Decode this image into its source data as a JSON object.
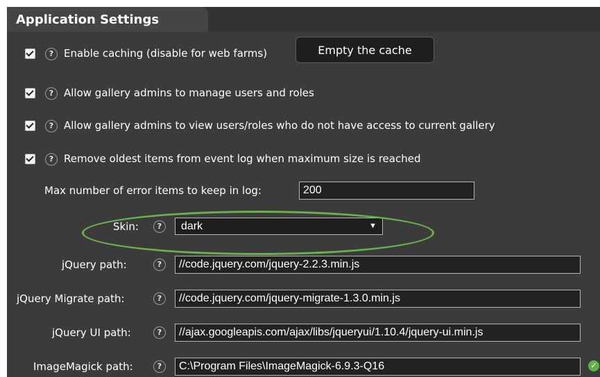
{
  "section": {
    "title": "Application Settings"
  },
  "checkboxes": [
    {
      "label": "Enable caching (disable for web farms)",
      "checked": true
    },
    {
      "label": "Allow gallery admins to manage users and roles",
      "checked": true
    },
    {
      "label": "Allow gallery admins to view users/roles who do not have access to current gallery",
      "checked": true
    },
    {
      "label": "Remove oldest items from event log when maximum size is reached",
      "checked": true
    }
  ],
  "empty_cache_button": "Empty the cache",
  "help_glyph": "?",
  "max_errors": {
    "label": "Max number of error items to keep in log:",
    "value": "200"
  },
  "skin": {
    "label": "Skin:",
    "value": "dark",
    "arrow": "▼"
  },
  "paths": [
    {
      "label": "jQuery path:",
      "value": "//code.jquery.com/jquery-2.2.3.min.js"
    },
    {
      "label": "jQuery Migrate path:",
      "value": "//code.jquery.com/jquery-migrate-1.3.0.min.js"
    },
    {
      "label": "jQuery UI path:",
      "value": "//ajax.googleapis.com/ajax/libs/jqueryui/1.10.4/jquery-ui.min.js"
    },
    {
      "label": "ImageMagick path:",
      "value": "C:\\Program Files\\ImageMagick-6.9.3-Q16"
    }
  ],
  "valid_icon_glyph": "✓",
  "colors": {
    "panel": "#3b3b3b",
    "highlight_ellipse": "#6ab04c",
    "valid": "#5fb346"
  }
}
